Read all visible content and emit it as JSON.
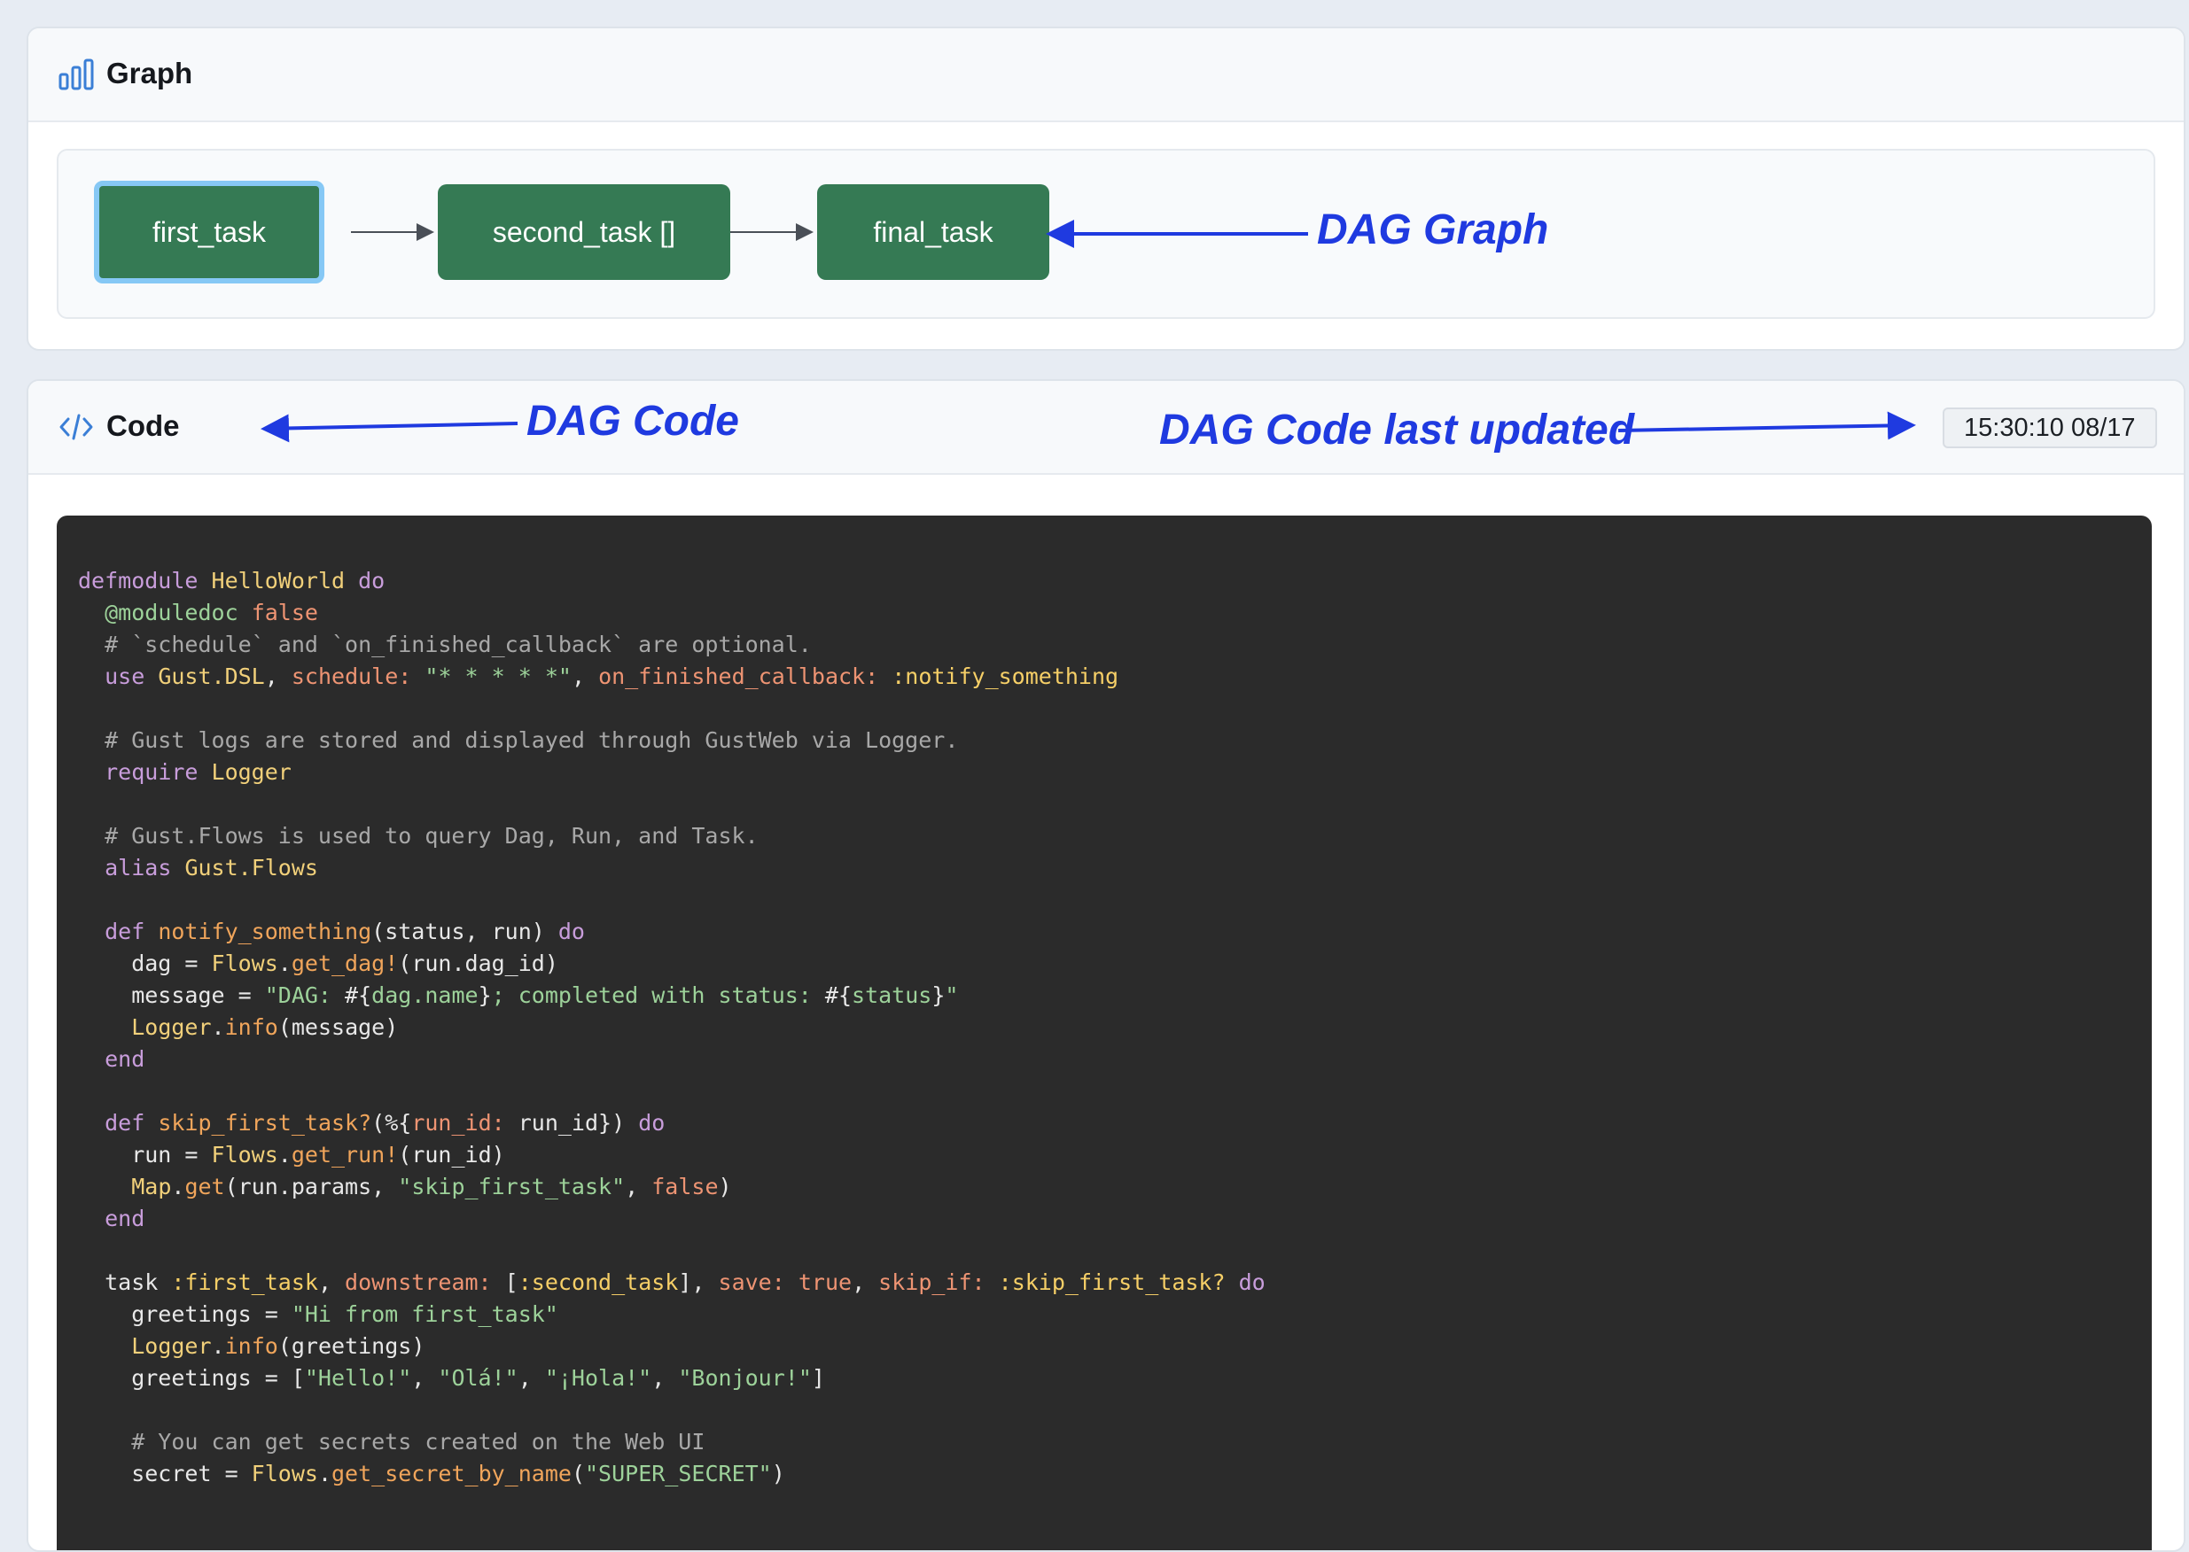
{
  "graph": {
    "title": "Graph",
    "icon": "bar-chart-icon",
    "nodes": [
      {
        "label": "first_task",
        "selected": true
      },
      {
        "label": "second_task []",
        "selected": false
      },
      {
        "label": "final_task",
        "selected": false
      }
    ],
    "node_color": "#357a54",
    "selected_border_color": "#86c8f5",
    "annotation": "DAG Graph"
  },
  "code": {
    "title": "Code",
    "icon": "code-icon",
    "annotation": "DAG Code",
    "last_updated_annotation": "DAG Code last updated",
    "last_updated": "15:30:10 08/17",
    "lines": [
      [
        [
          "k",
          "defmodule"
        ],
        [
          "p",
          " "
        ],
        [
          "m",
          "HelloWorld"
        ],
        [
          "p",
          " "
        ],
        [
          "k",
          "do"
        ]
      ],
      [
        [
          "p",
          "  "
        ],
        [
          "s",
          "@moduledoc"
        ],
        [
          "p",
          " "
        ],
        [
          "a",
          "false"
        ]
      ],
      [
        [
          "c",
          "  # `schedule` and `on_finished_callback` are optional."
        ]
      ],
      [
        [
          "p",
          "  "
        ],
        [
          "k",
          "use"
        ],
        [
          "p",
          " "
        ],
        [
          "m",
          "Gust.DSL"
        ],
        [
          "p",
          ", "
        ],
        [
          "a",
          "schedule:"
        ],
        [
          "p",
          " "
        ],
        [
          "s",
          "\"* * * * *\""
        ],
        [
          "p",
          ", "
        ],
        [
          "a",
          "on_finished_callback:"
        ],
        [
          "p",
          " "
        ],
        [
          "y",
          ":notify_something"
        ]
      ],
      [],
      [
        [
          "c",
          "  # Gust logs are stored and displayed through GustWeb via Logger."
        ]
      ],
      [
        [
          "p",
          "  "
        ],
        [
          "k",
          "require"
        ],
        [
          "p",
          " "
        ],
        [
          "m",
          "Logger"
        ]
      ],
      [],
      [
        [
          "c",
          "  # Gust.Flows is used to query Dag, Run, and Task."
        ]
      ],
      [
        [
          "p",
          "  "
        ],
        [
          "k",
          "alias"
        ],
        [
          "p",
          " "
        ],
        [
          "m",
          "Gust.Flows"
        ]
      ],
      [],
      [
        [
          "p",
          "  "
        ],
        [
          "k",
          "def"
        ],
        [
          "p",
          " "
        ],
        [
          "f",
          "notify_something"
        ],
        [
          "p",
          "(status, run) "
        ],
        [
          "k",
          "do"
        ]
      ],
      [
        [
          "p",
          "    dag = "
        ],
        [
          "m",
          "Flows"
        ],
        [
          "p",
          "."
        ],
        [
          "f",
          "get_dag!"
        ],
        [
          "p",
          "(run.dag_id)"
        ]
      ],
      [
        [
          "p",
          "    message = "
        ],
        [
          "s",
          "\"DAG: "
        ],
        [
          "p",
          "#{"
        ],
        [
          "s",
          "dag.name"
        ],
        [
          "p",
          "}"
        ],
        [
          "s",
          "; completed with status: "
        ],
        [
          "p",
          "#{"
        ],
        [
          "s",
          "status"
        ],
        [
          "p",
          "}"
        ],
        [
          "s",
          "\""
        ]
      ],
      [
        [
          "p",
          "    "
        ],
        [
          "m",
          "Logger"
        ],
        [
          "p",
          "."
        ],
        [
          "f",
          "info"
        ],
        [
          "p",
          "(message)"
        ]
      ],
      [
        [
          "p",
          "  "
        ],
        [
          "k",
          "end"
        ]
      ],
      [],
      [
        [
          "p",
          "  "
        ],
        [
          "k",
          "def"
        ],
        [
          "p",
          " "
        ],
        [
          "f",
          "skip_first_task?"
        ],
        [
          "p",
          "(%{"
        ],
        [
          "a",
          "run_id:"
        ],
        [
          "p",
          " run_id}) "
        ],
        [
          "k",
          "do"
        ]
      ],
      [
        [
          "p",
          "    run = "
        ],
        [
          "m",
          "Flows"
        ],
        [
          "p",
          "."
        ],
        [
          "f",
          "get_run!"
        ],
        [
          "p",
          "(run_id)"
        ]
      ],
      [
        [
          "p",
          "    "
        ],
        [
          "m",
          "Map"
        ],
        [
          "p",
          "."
        ],
        [
          "f",
          "get"
        ],
        [
          "p",
          "(run.params, "
        ],
        [
          "s",
          "\"skip_first_task\""
        ],
        [
          "p",
          ", "
        ],
        [
          "a",
          "false"
        ],
        [
          "p",
          ")"
        ]
      ],
      [
        [
          "p",
          "  "
        ],
        [
          "k",
          "end"
        ]
      ],
      [],
      [
        [
          "p",
          "  task "
        ],
        [
          "y",
          ":first_task"
        ],
        [
          "p",
          ", "
        ],
        [
          "a",
          "downstream:"
        ],
        [
          "p",
          " ["
        ],
        [
          "y",
          ":second_task"
        ],
        [
          "p",
          "], "
        ],
        [
          "a",
          "save:"
        ],
        [
          "p",
          " "
        ],
        [
          "a",
          "true"
        ],
        [
          "p",
          ", "
        ],
        [
          "a",
          "skip_if:"
        ],
        [
          "p",
          " "
        ],
        [
          "y",
          ":skip_first_task?"
        ],
        [
          "p",
          " "
        ],
        [
          "k",
          "do"
        ]
      ],
      [
        [
          "p",
          "    greetings = "
        ],
        [
          "s",
          "\"Hi from first_task\""
        ]
      ],
      [
        [
          "p",
          "    "
        ],
        [
          "m",
          "Logger"
        ],
        [
          "p",
          "."
        ],
        [
          "f",
          "info"
        ],
        [
          "p",
          "(greetings)"
        ]
      ],
      [
        [
          "p",
          "    greetings = ["
        ],
        [
          "s",
          "\"Hello!\""
        ],
        [
          "p",
          ", "
        ],
        [
          "s",
          "\"Olá!\""
        ],
        [
          "p",
          ", "
        ],
        [
          "s",
          "\"¡Hola!\""
        ],
        [
          "p",
          ", "
        ],
        [
          "s",
          "\"Bonjour!\""
        ],
        [
          "p",
          "]"
        ]
      ],
      [],
      [
        [
          "c",
          "    # You can get secrets created on the Web UI"
        ]
      ],
      [
        [
          "p",
          "    secret = "
        ],
        [
          "m",
          "Flows"
        ],
        [
          "p",
          "."
        ],
        [
          "f",
          "get_secret_by_name"
        ],
        [
          "p",
          "("
        ],
        [
          "s",
          "\"SUPER_SECRET\""
        ],
        [
          "p",
          ")"
        ]
      ]
    ]
  },
  "colors": {
    "annotation": "#1f3ae0",
    "code_background": "#2b2b2b",
    "icon": "#3b7fd6"
  }
}
